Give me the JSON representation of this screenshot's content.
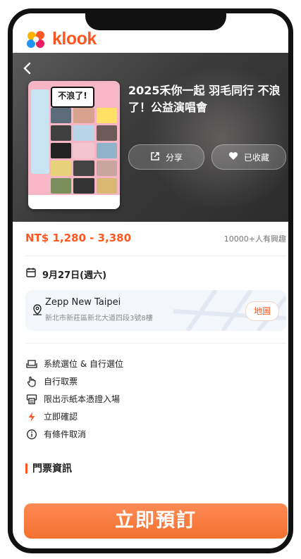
{
  "brand": {
    "name": "klook",
    "accent": "#ff5722"
  },
  "hero": {
    "title": "2025禾你一起 羽毛同行 不浪了！公益演唱會",
    "poster_caption": "不浪了!",
    "share_label": "分享",
    "saved_label": "已收藏"
  },
  "price": {
    "range": "NT$ 1,280 - 3,380",
    "interest": "10000+人有興趣"
  },
  "event": {
    "date": "9月27日(週六)"
  },
  "venue": {
    "name": "Zepp New Taipei",
    "address": "新北市新莊區新北大道四段3號8樓",
    "map_label": "地圖"
  },
  "features": [
    {
      "icon": "seat-icon",
      "label": "系統選位 & 自行選位"
    },
    {
      "icon": "hand-icon",
      "label": "自行取票"
    },
    {
      "icon": "printer-icon",
      "label": "限出示紙本憑證入場"
    },
    {
      "icon": "lightning-icon",
      "label": "立即確認"
    },
    {
      "icon": "info-icon",
      "label": "有條件取消"
    }
  ],
  "section": {
    "title": "門票資訊"
  },
  "cta": {
    "label": "立即預訂"
  }
}
